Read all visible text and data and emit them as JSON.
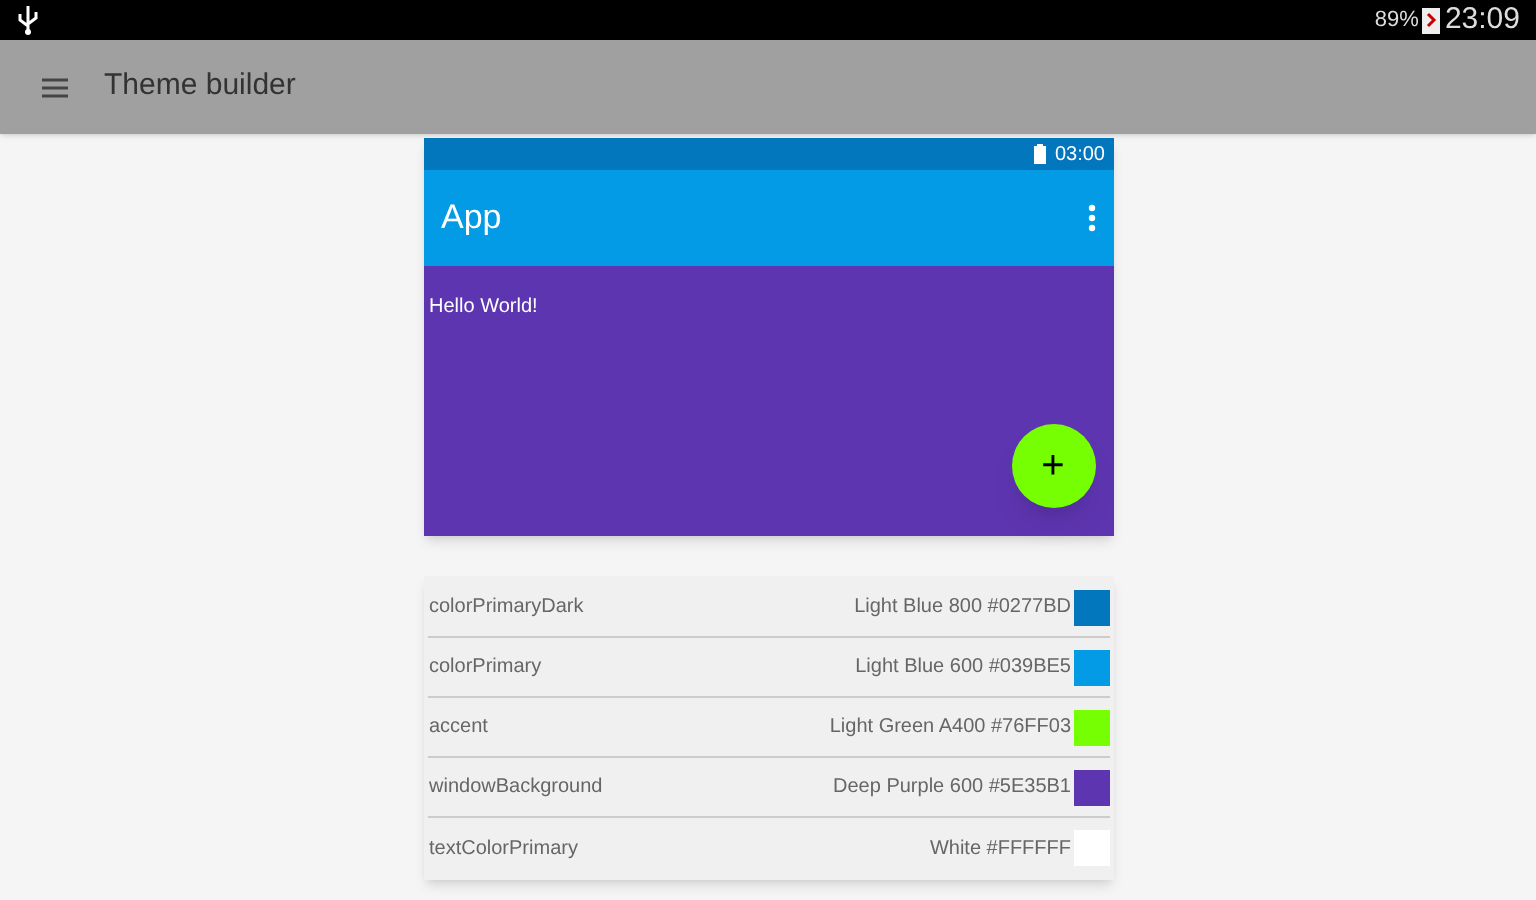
{
  "status_bar": {
    "battery": "89%",
    "time": "23:09"
  },
  "toolbar": {
    "title": "Theme builder"
  },
  "preview": {
    "status_time": "03:00",
    "app_title": "App",
    "body_text": "Hello World!",
    "fab": "+"
  },
  "palette": [
    {
      "name": "colorPrimaryDark",
      "value": "Light Blue 800 #0277BD",
      "color": "#0277bd"
    },
    {
      "name": "colorPrimary",
      "value": "Light Blue 600 #039BE5",
      "color": "#039be5"
    },
    {
      "name": "accent",
      "value": "Light Green A400 #76FF03",
      "color": "#76ff03"
    },
    {
      "name": "windowBackground",
      "value": "Deep Purple 600 #5E35B1",
      "color": "#5e35b1"
    },
    {
      "name": "textColorPrimary",
      "value": "White #FFFFFF",
      "color": "#ffffff"
    }
  ]
}
